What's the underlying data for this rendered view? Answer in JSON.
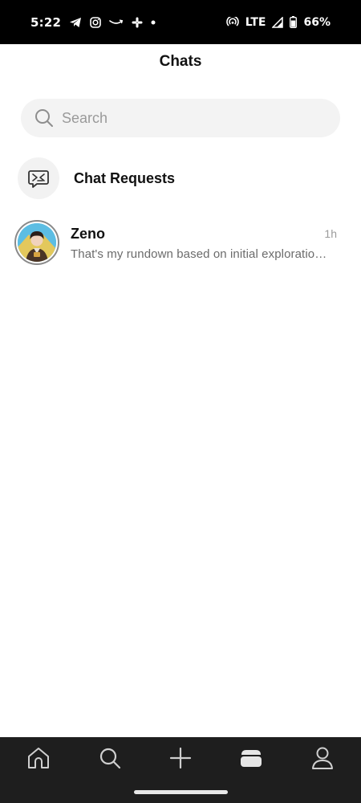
{
  "status_bar": {
    "time": "5:22",
    "network": "LTE",
    "battery": "66%",
    "left_icons": [
      "telegram-icon",
      "instagram-icon",
      "amazon-icon",
      "slack-icon",
      "dot-icon"
    ],
    "right_icons": [
      "hotspot-icon",
      "signal-icon",
      "battery-icon"
    ]
  },
  "header": {
    "title": "Chats"
  },
  "search": {
    "placeholder": "Search",
    "icon": "search-icon"
  },
  "chat_requests": {
    "label": "Chat Requests",
    "icon": "chat-requests-icon"
  },
  "chats": [
    {
      "name": "Zeno",
      "time": "1h",
      "preview": "That's my rundown based on initial exploratio…"
    }
  ],
  "bottom_nav": {
    "items": [
      "home-icon",
      "search-icon",
      "plus-icon",
      "chats-icon",
      "profile-icon"
    ],
    "active": "chats-icon"
  },
  "colors": {
    "status_bar_bg": "#000000",
    "nav_bg": "#1e1e1e",
    "search_bg": "#f3f3f3",
    "text_primary": "#111111",
    "text_secondary": "#6b6b6b"
  }
}
